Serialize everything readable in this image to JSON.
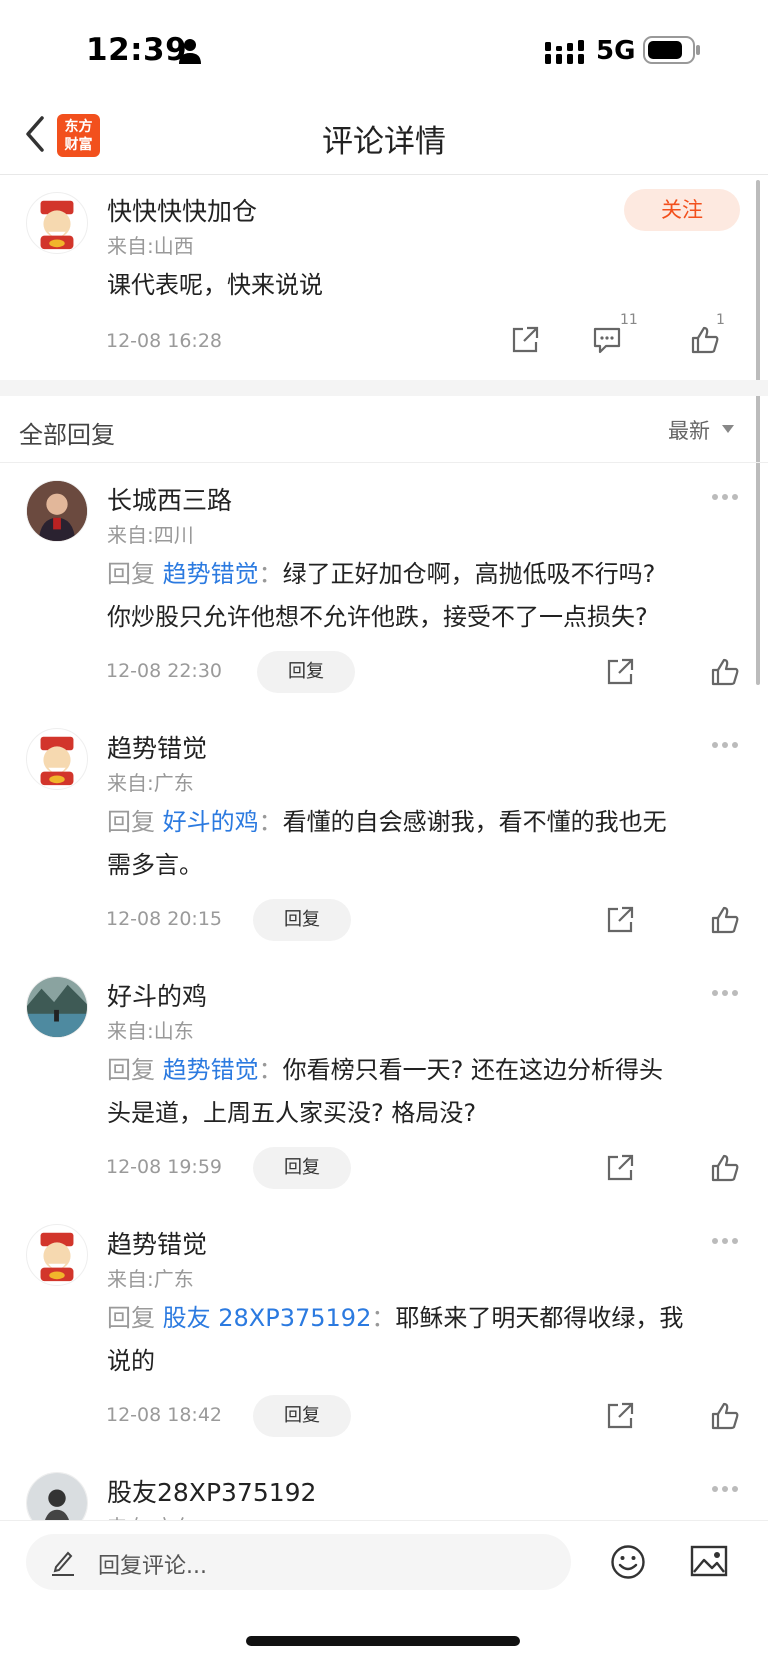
{
  "status_bar": {
    "time": "12:39",
    "network": "5G"
  },
  "nav": {
    "logo_line1": "东方",
    "logo_line2": "财富",
    "title": "评论详情"
  },
  "main_comment": {
    "username": "快快快快加仓",
    "location": "来自:山西",
    "text": "课代表呢，快来说说",
    "time": "12-08 16:28",
    "comment_count": "11",
    "like_count": "1",
    "follow_label": "关注"
  },
  "replies_header": {
    "title": "全部回复",
    "sort_label": "最新"
  },
  "replies": [
    {
      "username": "长城西三路",
      "location": "来自:四川",
      "reply_prefix": "回复",
      "reply_to": "趋势错觉",
      "colon": "：",
      "text_line1": "绿了正好加仓啊，高抛低吸不行吗?",
      "text_line2": "你炒股只允许他想不允许他跌，接受不了一点损失?",
      "time": "12-08 22:30",
      "reply_label": "回复"
    },
    {
      "username": "趋势错觉",
      "location": "来自:广东",
      "reply_prefix": "回复",
      "reply_to": "好斗的鸡",
      "colon": "：",
      "text_line1": "看懂的自会感谢我，看不懂的我也无",
      "text_line2": "需多言。",
      "time": "12-08 20:15",
      "reply_label": "回复"
    },
    {
      "username": "好斗的鸡",
      "location": "来自:山东",
      "reply_prefix": "回复",
      "reply_to": "趋势错觉",
      "colon": "：",
      "text_line1": "你看榜只看一天? 还在这边分析得头",
      "text_line2": "头是道，上周五人家买没? 格局没?",
      "time": "12-08 19:59",
      "reply_label": "回复"
    },
    {
      "username": "趋势错觉",
      "location": "来自:广东",
      "reply_prefix": "回复",
      "reply_to": "股友 28XP375192",
      "colon": "：",
      "text_line1": "耶稣来了明天都得收绿，我",
      "text_line2": "说的",
      "time": "12-08 18:42",
      "reply_label": "回复"
    },
    {
      "username": "股友28XP375192",
      "location": "来自:广东"
    }
  ],
  "bottom_bar": {
    "placeholder": "回复评论..."
  },
  "colors": {
    "brand": "#f2501d",
    "link": "#2b7ae0"
  }
}
